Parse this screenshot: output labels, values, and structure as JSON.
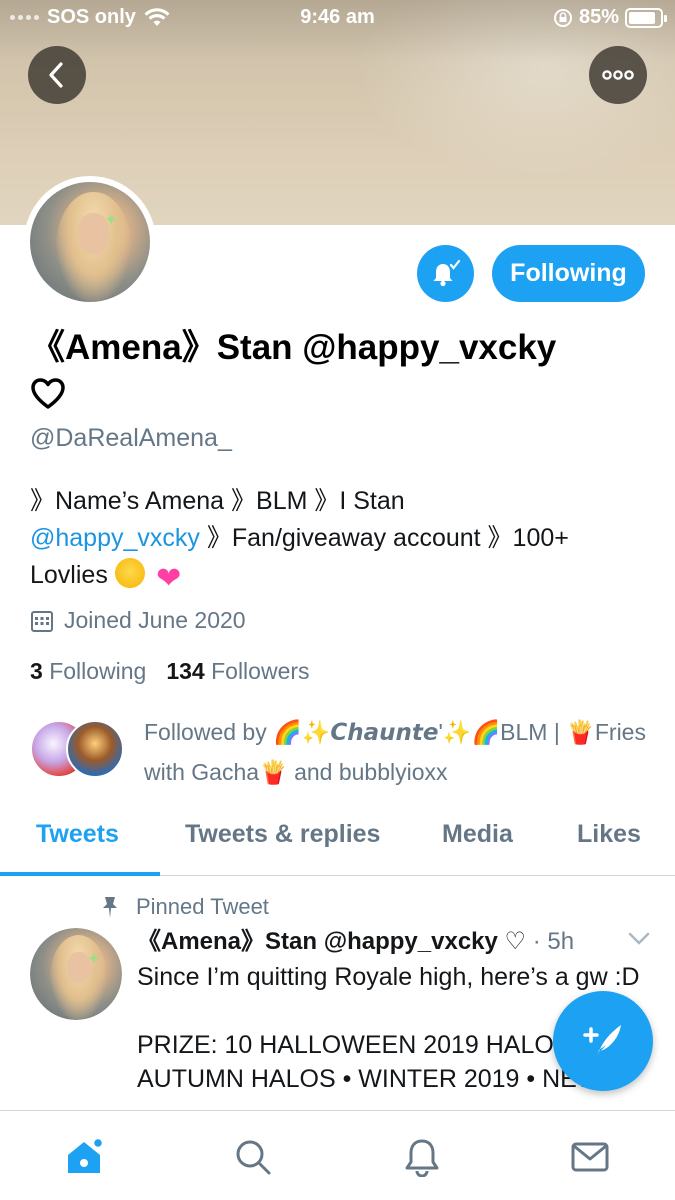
{
  "status_bar": {
    "carrier": "SOS only",
    "time": "9:46 am",
    "battery": "85%",
    "battery_level": 0.85
  },
  "header": {
    "back_icon": "chevron-left-icon",
    "more_icon": "more-dots-icon"
  },
  "profile": {
    "display_name": "《Amena》Stan @happy_vxcky",
    "name_emoji": "♡",
    "handle": "@DaRealAmena_",
    "bio_part1": "》Name’s Amena 》BLM 》I Stan",
    "bio_link": "@happy_vxcky",
    "bio_part2": "》Fan/giveaway account 》100+ Lovlies",
    "joined": "Joined June 2020",
    "following_count": "3",
    "following_label": "Following",
    "followers_count": "134",
    "followers_label": "Followers",
    "followed_by_text": "Followed by 🌈✨𝘾𝙝𝙖𝙪𝙣𝙩𝙚'✨🌈BLM | 🍟Fries with Gacha🍟 and bubblyioxx"
  },
  "actions": {
    "notify_icon": "bell-plus-icon",
    "following_button": "Following"
  },
  "tabs": [
    {
      "label": "Tweets",
      "active": true
    },
    {
      "label": "Tweets & replies",
      "active": false
    },
    {
      "label": "Media",
      "active": false
    },
    {
      "label": "Likes",
      "active": false
    }
  ],
  "pinned_tweet": {
    "pinned_label": "Pinned Tweet",
    "author_name": "《Amena》Stan @happy_vxcky ♡",
    "time": "· 5h",
    "text": "Since I’m quitting Royale high, here’s a gw :D\n\nPRIZE: 10 HALLOWEEN 2019 HALOS • 2 AUTUMN HALOS • WINTER 2019 • NEW"
  },
  "fab": {
    "icon": "compose-tweet-icon"
  },
  "bottom_nav": [
    {
      "icon": "home-icon",
      "active": true
    },
    {
      "icon": "search-icon",
      "active": false
    },
    {
      "icon": "notifications-icon",
      "active": false
    },
    {
      "icon": "messages-icon",
      "active": false
    }
  ],
  "colors": {
    "accent": "#1da1f2",
    "link": "#1b95e0",
    "secondary_text": "#657786"
  }
}
